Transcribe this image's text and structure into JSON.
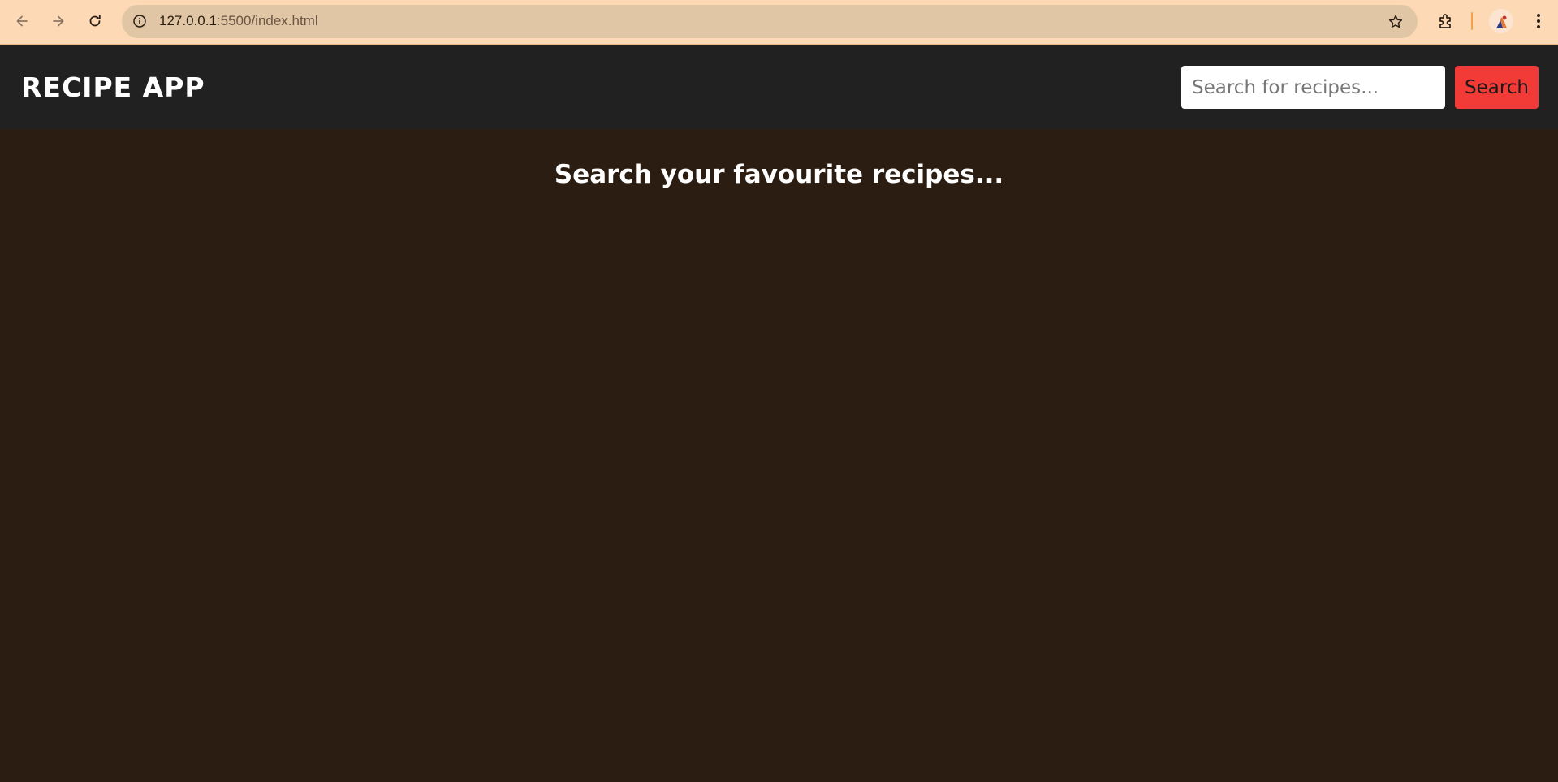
{
  "browser": {
    "url_host": "127.0.0.1",
    "url_path": ":5500/index.html",
    "accent_color": "#fdd9b5",
    "icons": [
      "back-icon",
      "forward-icon",
      "reload-icon",
      "site-info-icon",
      "star-icon",
      "extensions-icon",
      "avatar",
      "menu-icon"
    ]
  },
  "header": {
    "title": "RECIPE APP",
    "background_color": "#212121"
  },
  "search": {
    "placeholder": "Search for recipes...",
    "value": "",
    "button_label": "Search",
    "button_color": "#f23a37"
  },
  "main": {
    "heading": "Search your favourite recipes...",
    "background_color": "#2b1d12"
  }
}
